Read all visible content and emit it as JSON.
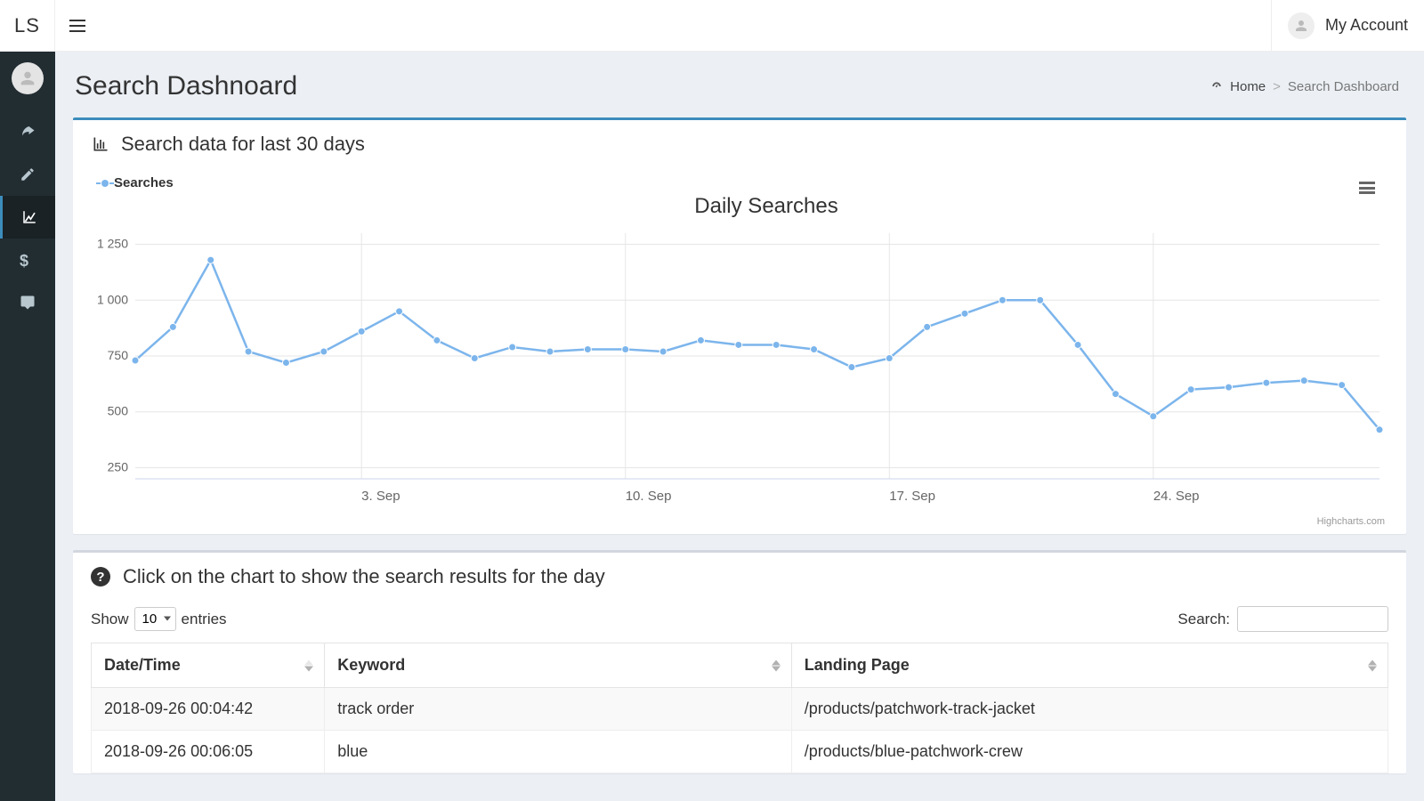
{
  "brand": "LS",
  "account_label": "My Account",
  "page_title": "Search Dashnoard",
  "breadcrumb": {
    "home": "Home",
    "current": "Search Dashboard"
  },
  "panel1_title": "Search data for last 30 days",
  "chart_data": {
    "type": "line",
    "title": "Daily Searches",
    "series": [
      {
        "name": "Searches",
        "values": [
          730,
          880,
          1180,
          770,
          720,
          770,
          860,
          950,
          820,
          740,
          790,
          770,
          780,
          780,
          770,
          820,
          800,
          800,
          780,
          700,
          740,
          880,
          940,
          1000,
          1000,
          800,
          580,
          480,
          600,
          610,
          630,
          640,
          620,
          420
        ]
      }
    ],
    "x_start_date": "2018-08-28",
    "x_ticks": [
      "3. Sep",
      "10. Sep",
      "17. Sep",
      "24. Sep"
    ],
    "y_ticks": [
      250,
      500,
      750,
      1000,
      1250
    ],
    "ylim": [
      200,
      1300
    ],
    "credits": "Highcharts.com"
  },
  "legend_label": "Searches",
  "panel2_hint": "Click on the chart to show the search results for the day",
  "table_controls": {
    "show": "Show",
    "entries": "entries",
    "page_size": "10",
    "search_label": "Search:"
  },
  "table": {
    "columns": [
      "Date/Time",
      "Keyword",
      "Landing Page"
    ],
    "rows": [
      {
        "datetime": "2018-09-26 00:04:42",
        "keyword": "track order",
        "landing": "/products/patchwork-track-jacket"
      },
      {
        "datetime": "2018-09-26 00:06:05",
        "keyword": "blue",
        "landing": "/products/blue-patchwork-crew"
      }
    ]
  }
}
